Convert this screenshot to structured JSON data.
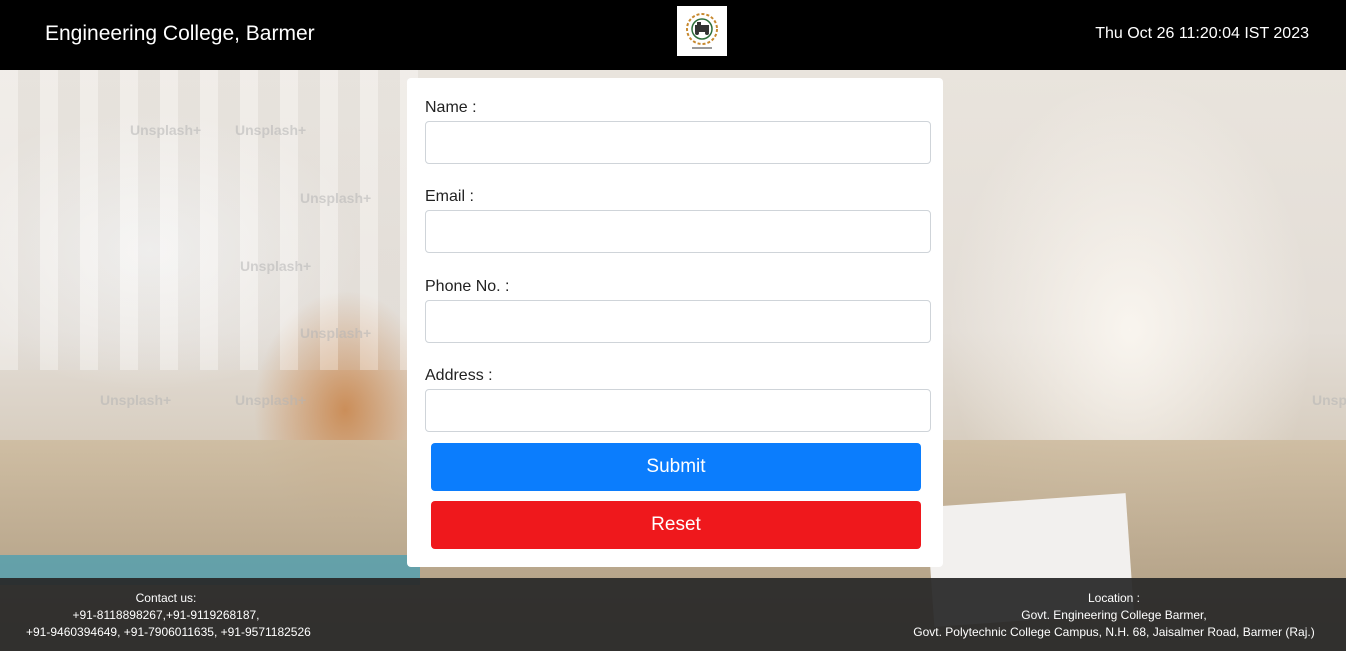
{
  "header": {
    "title": "Engineering College, Barmer",
    "logo_icon": "college-seal-logo",
    "datetime": "Thu Oct 26 11:20:04 IST 2023"
  },
  "form": {
    "fields": [
      {
        "label": "Name :",
        "value": "",
        "placeholder": ""
      },
      {
        "label": "Email :",
        "value": "",
        "placeholder": ""
      },
      {
        "label": "Phone No. :",
        "value": "",
        "placeholder": ""
      },
      {
        "label": "Address :",
        "value": "",
        "placeholder": ""
      }
    ],
    "submit_label": "Submit",
    "reset_label": "Reset"
  },
  "footer": {
    "contact": {
      "heading": "Contact us:",
      "line1": "+91-8118898267,+91-9119268187,",
      "line2": "+91-9460394649, +91-7906011635, +91-9571182526"
    },
    "location": {
      "heading": "Location :",
      "line1": "Govt. Engineering College Barmer,",
      "line2": "Govt. Polytechnic College Campus, N.H. 68, Jaisalmer Road, Barmer (Raj.)"
    }
  },
  "background": {
    "watermarks": [
      "Unsplash+",
      "Unsplash+",
      "Unsplash+",
      "Unsplash+",
      "Unsplash+",
      "Unsplash+",
      "Unsplash+",
      "Unsplash+"
    ]
  },
  "colors": {
    "header_bg": "#000000",
    "submit": "#0b7dfd",
    "reset": "#ef181c",
    "footer_bg": "#282828"
  }
}
